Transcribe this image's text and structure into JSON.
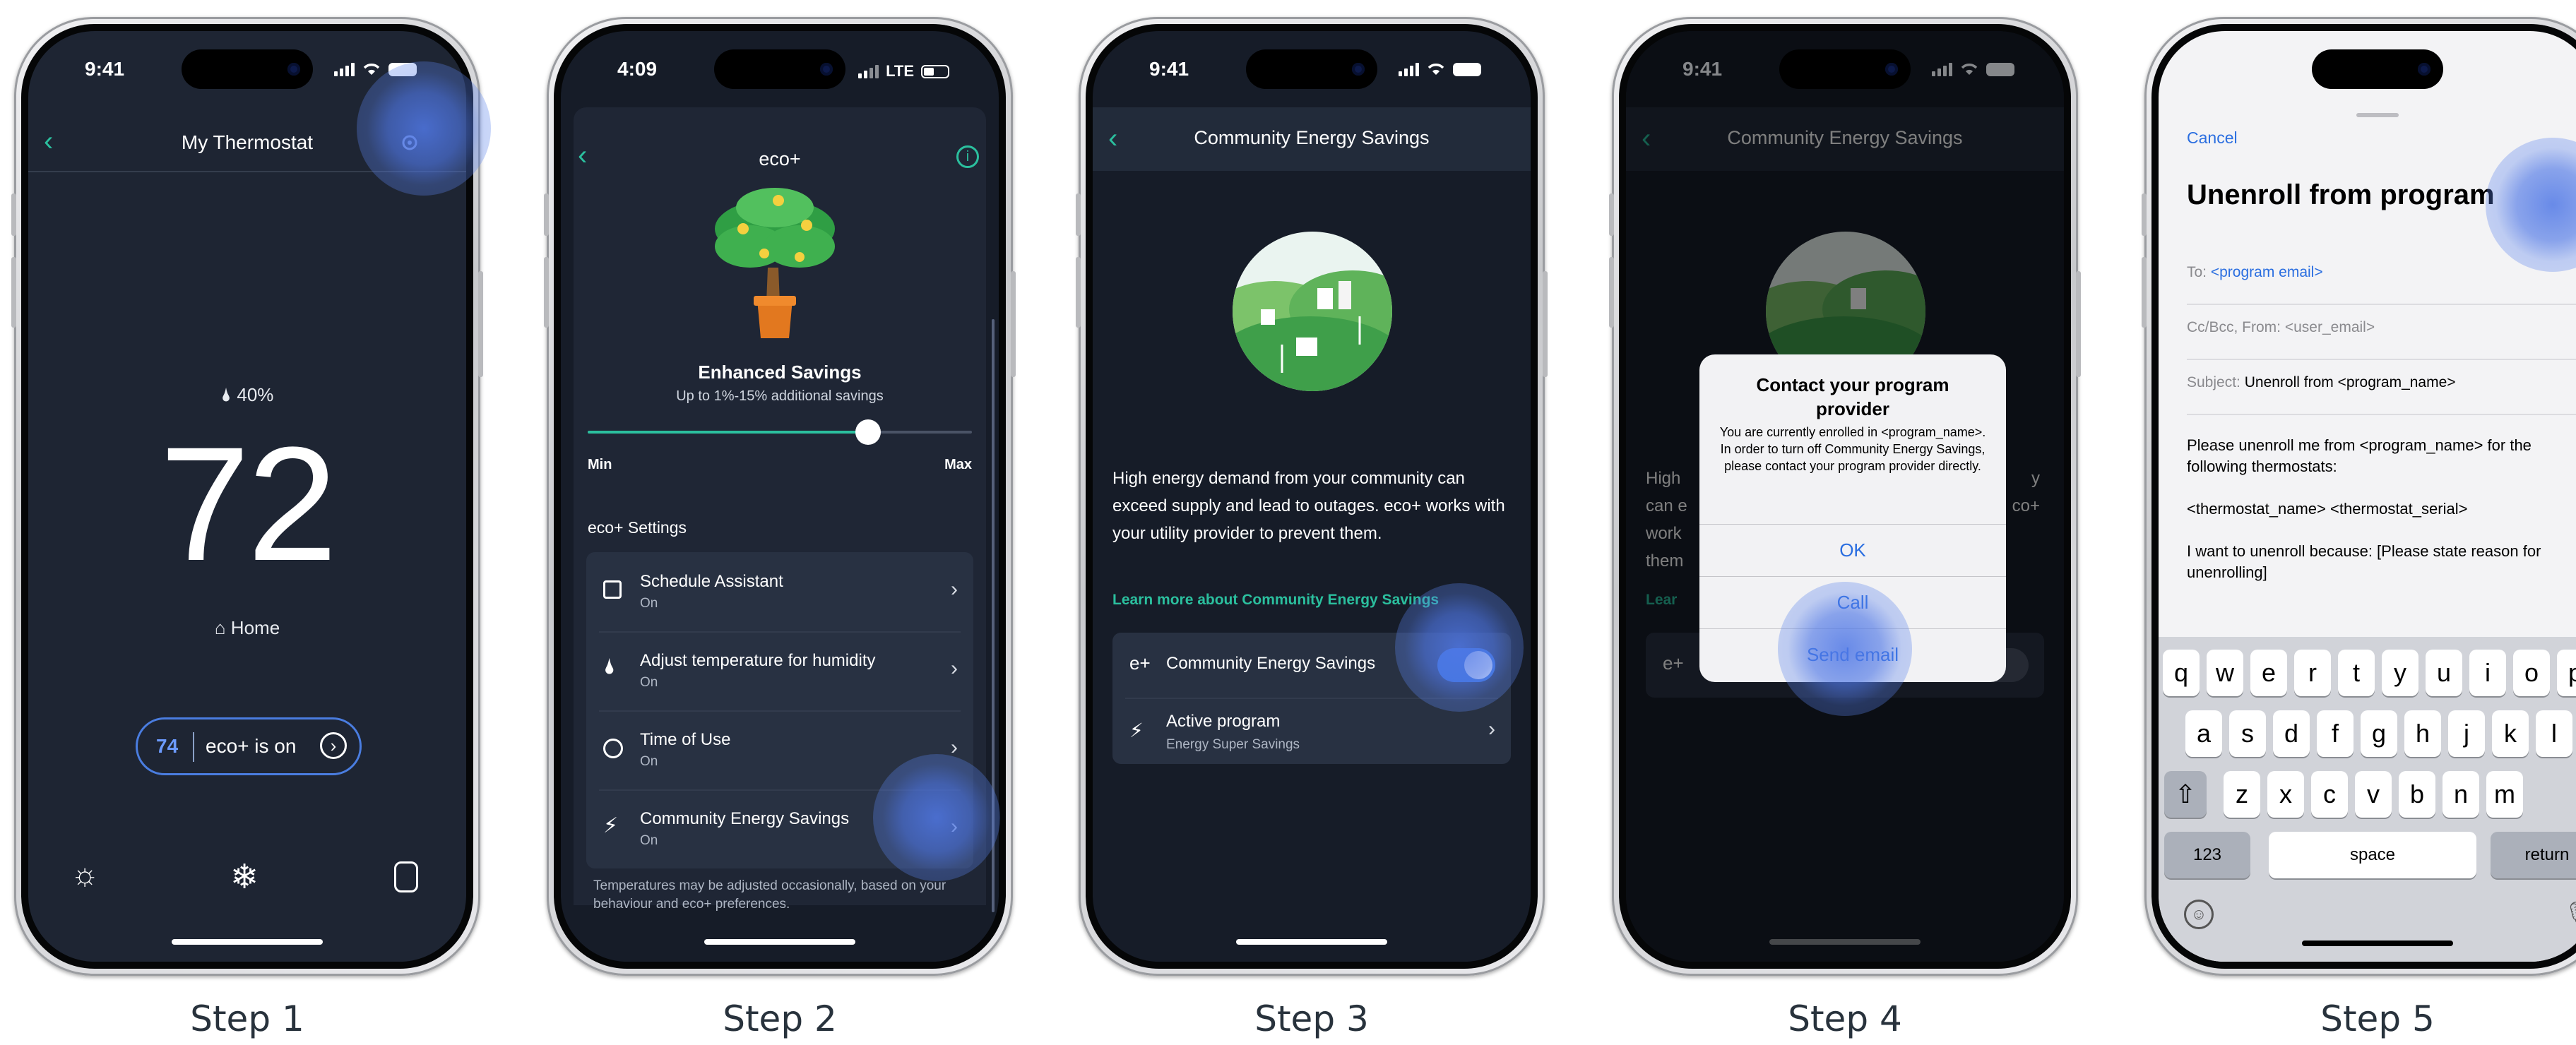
{
  "steps": [
    {
      "label": "Step 1"
    },
    {
      "label": "Step 2"
    },
    {
      "label": "Step 3"
    },
    {
      "label": "Step 4"
    },
    {
      "label": "Step 5"
    }
  ],
  "step1": {
    "time": "9:41",
    "title": "My Thermostat",
    "humidity": "40%",
    "temperature": "72",
    "comfort": "Home",
    "setpoint": "74",
    "eco_status": "eco+ is on"
  },
  "step2": {
    "time": "4:09",
    "network": "LTE",
    "title": "eco+",
    "hero_title": "Enhanced Savings",
    "hero_sub": "Up to 1%-15% additional savings",
    "slider_min": "Min",
    "slider_max": "Max",
    "slider_value": 0.73,
    "section": "eco+ Settings",
    "items": [
      {
        "title": "Schedule Assistant",
        "state": "On"
      },
      {
        "title": "Adjust temperature for humidity",
        "state": "On"
      },
      {
        "title": "Time of Use",
        "state": "On"
      },
      {
        "title": "Community Energy Savings",
        "state": "On"
      }
    ],
    "footer": "Temperatures may be adjusted occasionally, based on your behaviour and eco+ preferences."
  },
  "step3": {
    "time": "9:41",
    "title": "Community Energy Savings",
    "body": "High energy demand from your community can exceed supply and lead to outages. eco+ works with your utility provider to prevent them.",
    "link": "Learn more about Community Energy Savings",
    "toggle_label": "Community Energy Savings",
    "toggle_on": true,
    "program_title": "Active program",
    "program_name": "Energy Super Savings"
  },
  "step4": {
    "time": "9:41",
    "title": "Community Energy Savings",
    "bg_lines": [
      "High",
      "can e",
      "work",
      "them"
    ],
    "bg_right": [
      "y",
      "co+"
    ],
    "bg_link": "Lear",
    "dialog_title": "Contact your program provider",
    "dialog_body": "You are currently enrolled in <program_name>. In order to turn off Community Energy Savings, please contact your program provider directly.",
    "ok": "OK",
    "call": "Call",
    "send_email": "Send email"
  },
  "step5": {
    "cancel": "Cancel",
    "subject_title": "Unenroll from program",
    "to_label": "To:",
    "to_value": "<program email>",
    "ccbcc": "Cc/Bcc, From:",
    "ccbcc_value": "<user_email>",
    "subject_label": "Subject:",
    "subject_value": "Unenroll from <program_name>",
    "body1": "Please unenroll me from <program_name> for the following thermostats:",
    "body2": "<thermostat_name> <thermostat_serial>",
    "body3": "I want to unenroll because: [Please state reason for unenrolling]",
    "row1": [
      "q",
      "w",
      "e",
      "r",
      "t",
      "y",
      "u",
      "i",
      "o",
      "p"
    ],
    "row2": [
      "a",
      "s",
      "d",
      "f",
      "g",
      "h",
      "j",
      "k",
      "l"
    ],
    "row3": [
      "z",
      "x",
      "c",
      "v",
      "b",
      "n",
      "m"
    ],
    "numbers": "123",
    "space": "space",
    "return": "return"
  }
}
